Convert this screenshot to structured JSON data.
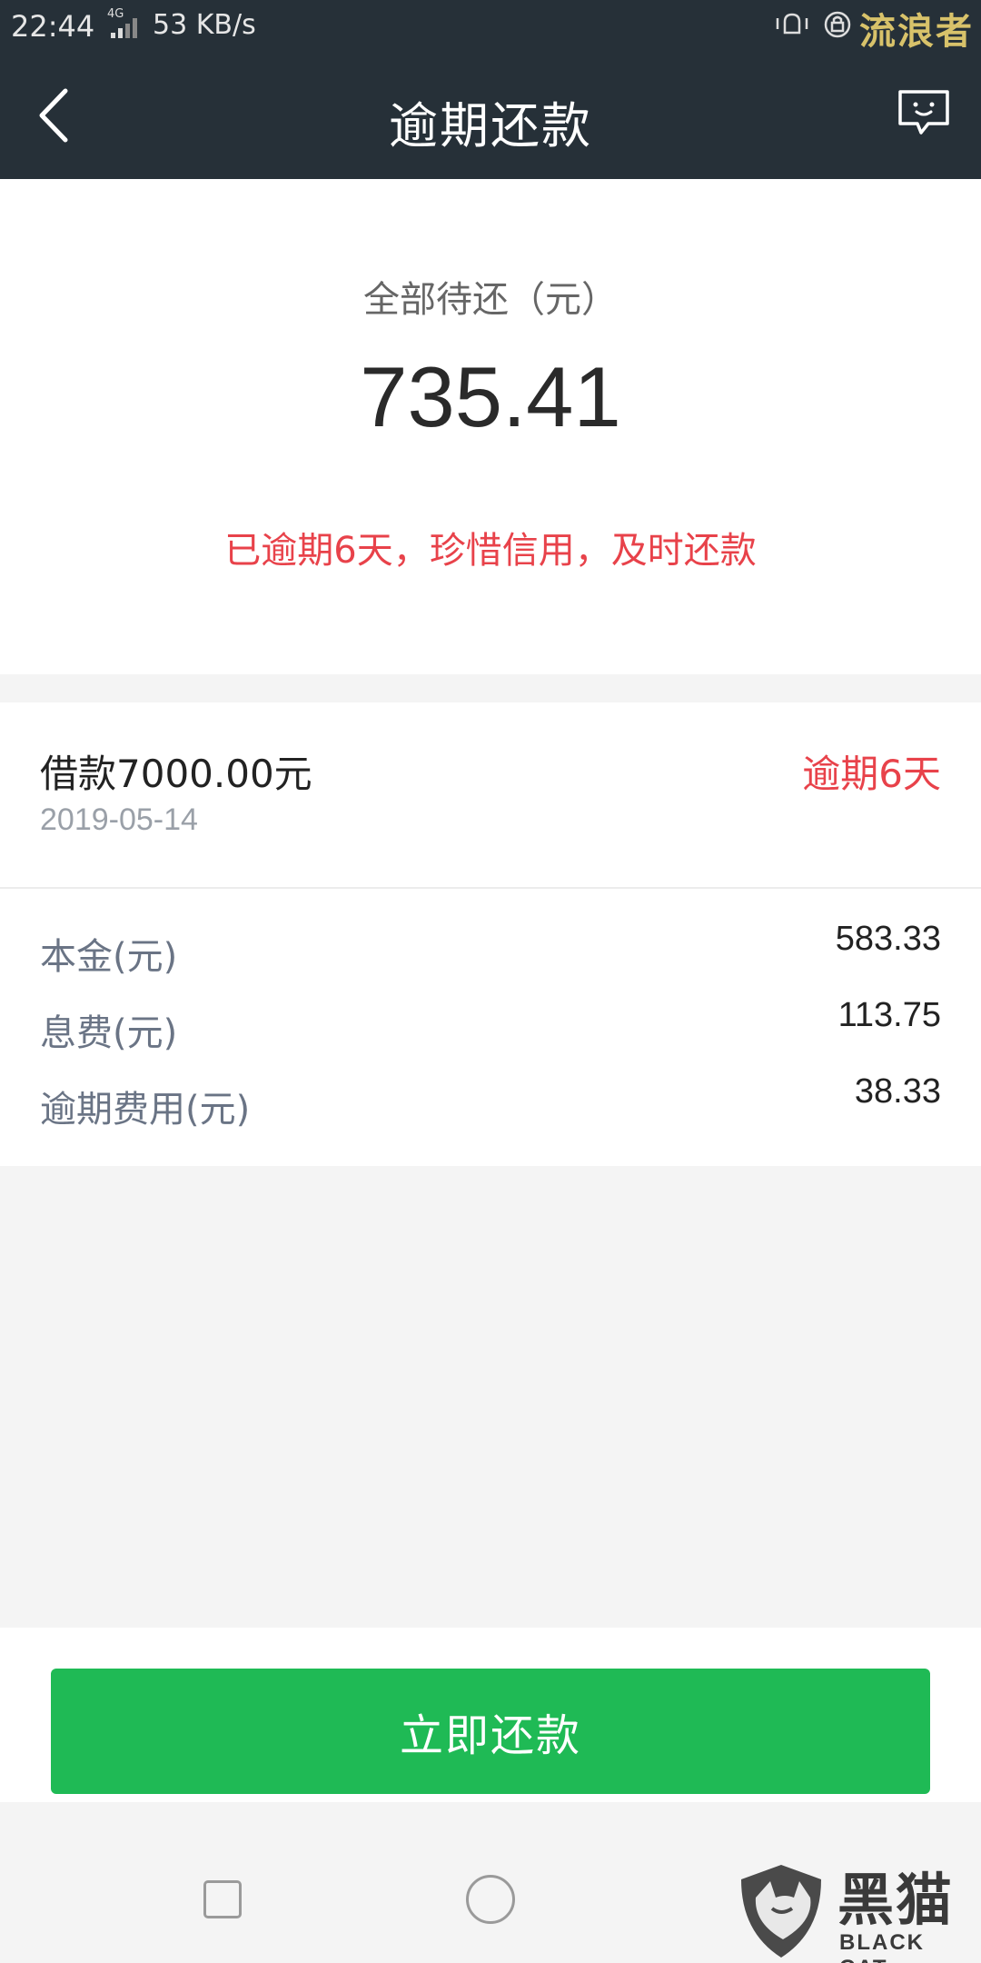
{
  "status_bar": {
    "time": "22:44",
    "network": "4G",
    "speed": "53 KB/s",
    "brand_overlay": "流浪者"
  },
  "header": {
    "title": "逾期还款",
    "back_icon": "chevron-left-icon",
    "feedback_icon": "chat-bubble-smile-icon"
  },
  "summary": {
    "label": "全部待还（元）",
    "amount": "735.41",
    "warning": "已逾期6天，珍惜信用，及时还款",
    "warning_color": "#e8424a"
  },
  "loan": {
    "title": "借款7000.00元",
    "date": "2019-05-14",
    "status": "逾期6天",
    "status_color": "#e8424a",
    "rows": [
      {
        "label": "本金(元)",
        "value": "583.33"
      },
      {
        "label": "息费(元)",
        "value": "113.75"
      },
      {
        "label": "逾期费用(元)",
        "value": "38.33"
      }
    ]
  },
  "action": {
    "pay_button_label": "立即还款",
    "button_color": "#1fba55"
  },
  "watermark": {
    "text": "黑猫",
    "subtext": "BLACK CAT"
  }
}
